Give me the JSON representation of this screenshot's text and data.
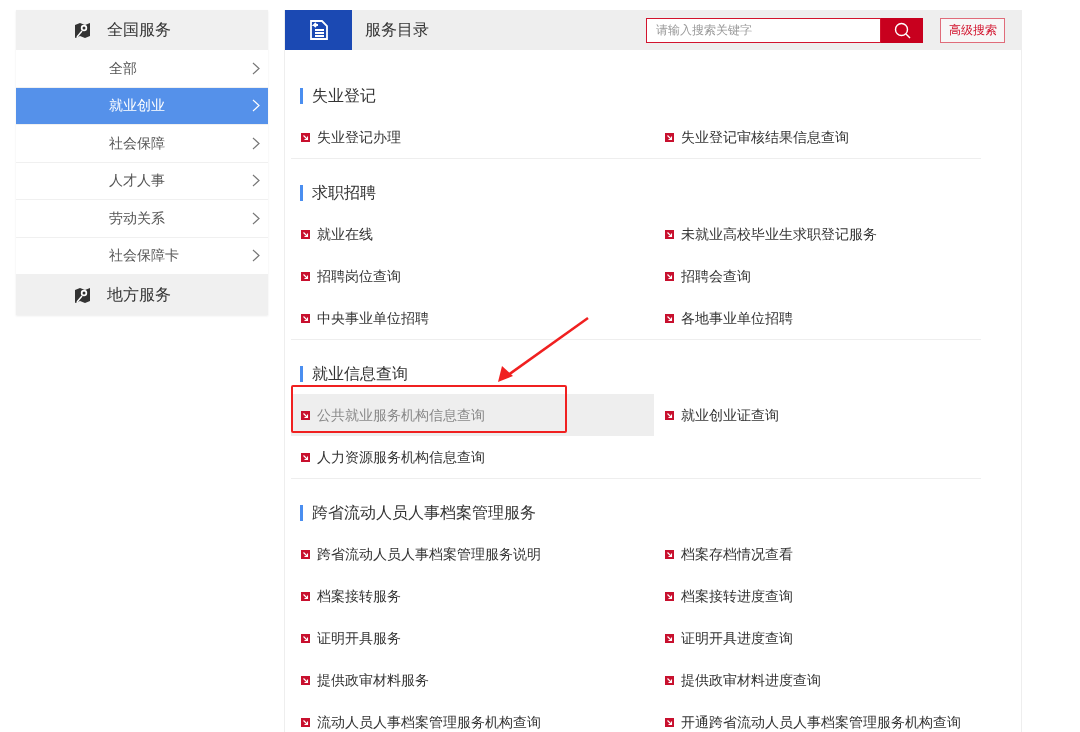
{
  "sidebar": {
    "groups": [
      {
        "title": "全国服务",
        "items": [
          {
            "label": "全部",
            "selected": false
          },
          {
            "label": "就业创业",
            "selected": true
          },
          {
            "label": "社会保障",
            "selected": false
          },
          {
            "label": "人才人事",
            "selected": false
          },
          {
            "label": "劳动关系",
            "selected": false
          },
          {
            "label": "社会保障卡",
            "selected": false
          }
        ]
      },
      {
        "title": "地方服务"
      }
    ]
  },
  "header": {
    "title": "服务目录",
    "search": {
      "placeholder": "请输入搜索关键字"
    },
    "advanced_button": "高级搜索"
  },
  "sections": [
    {
      "title": "失业登记",
      "items": [
        {
          "label": "失业登记办理",
          "selected": false,
          "annotated": false
        },
        {
          "label": "失业登记审核结果信息查询",
          "selected": false,
          "annotated": false
        }
      ]
    },
    {
      "title": "求职招聘",
      "items": [
        {
          "label": "就业在线",
          "selected": false,
          "annotated": false
        },
        {
          "label": "未就业高校毕业生求职登记服务",
          "selected": false,
          "annotated": false
        },
        {
          "label": "招聘岗位查询",
          "selected": false,
          "annotated": false
        },
        {
          "label": "招聘会查询",
          "selected": false,
          "annotated": false
        },
        {
          "label": "中央事业单位招聘",
          "selected": false,
          "annotated": false
        },
        {
          "label": "各地事业单位招聘",
          "selected": false,
          "annotated": false
        }
      ]
    },
    {
      "title": "就业信息查询",
      "items": [
        {
          "label": "公共就业服务机构信息查询",
          "selected": true,
          "annotated": true
        },
        {
          "label": "就业创业证查询",
          "selected": false,
          "annotated": false
        },
        {
          "label": "人力资源服务机构信息查询",
          "selected": false,
          "annotated": false
        }
      ]
    },
    {
      "title": "跨省流动人员人事档案管理服务",
      "items": [
        {
          "label": "跨省流动人员人事档案管理服务说明",
          "selected": false,
          "annotated": false
        },
        {
          "label": "档案存档情况查看",
          "selected": false,
          "annotated": false
        },
        {
          "label": "档案接转服务",
          "selected": false,
          "annotated": false
        },
        {
          "label": "档案接转进度查询",
          "selected": false,
          "annotated": false
        },
        {
          "label": "证明开具服务",
          "selected": false,
          "annotated": false
        },
        {
          "label": "证明开具进度查询",
          "selected": false,
          "annotated": false
        },
        {
          "label": "提供政审材料服务",
          "selected": false,
          "annotated": false
        },
        {
          "label": "提供政审材料进度查询",
          "selected": false,
          "annotated": false
        },
        {
          "label": "流动人员人事档案管理服务机构查询",
          "selected": false,
          "annotated": false
        },
        {
          "label": "开通跨省流动人员人事档案管理服务机构查询",
          "selected": false,
          "annotated": false
        }
      ]
    }
  ]
}
